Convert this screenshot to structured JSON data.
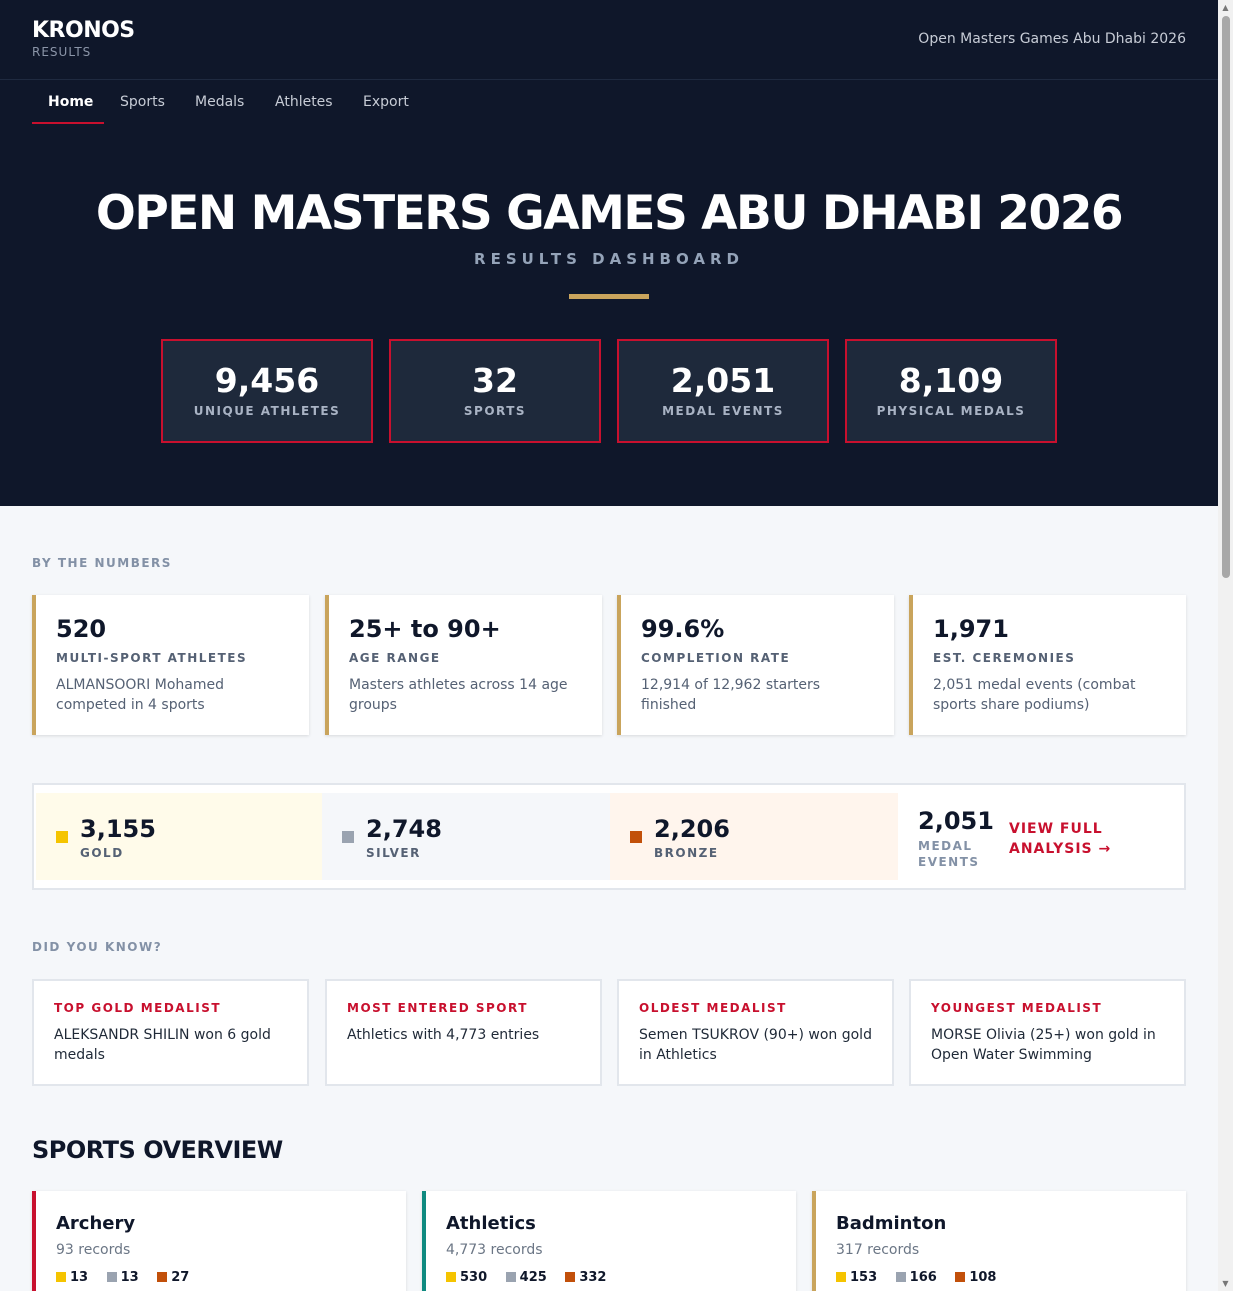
{
  "brand": {
    "name": "KRONOS",
    "sub": "RESULTS"
  },
  "header": {
    "event_name": "Open Masters Games Abu Dhabi 2026"
  },
  "nav": {
    "items": [
      "Home",
      "Sports",
      "Medals",
      "Athletes",
      "Export"
    ],
    "active": "Home"
  },
  "hero": {
    "title": "OPEN MASTERS GAMES ABU DHABI 2026",
    "subtitle": "RESULTS DASHBOARD",
    "stats": [
      {
        "value": "9,456",
        "label": "UNIQUE ATHLETES"
      },
      {
        "value": "32",
        "label": "SPORTS"
      },
      {
        "value": "2,051",
        "label": "MEDAL EVENTS"
      },
      {
        "value": "8,109",
        "label": "PHYSICAL MEDALS"
      }
    ]
  },
  "by_numbers": {
    "label": "BY THE NUMBERS",
    "cards": [
      {
        "value": "520",
        "label": "MULTI-SPORT ATHLETES",
        "desc": "ALMANSOORI Mohamed competed in 4 sports"
      },
      {
        "value": "25+ to 90+",
        "label": "AGE RANGE",
        "desc": "Masters athletes across 14 age groups"
      },
      {
        "value": "99.6%",
        "label": "COMPLETION RATE",
        "desc": "12,914 of 12,962 starters finished"
      },
      {
        "value": "1,971",
        "label": "EST. CEREMONIES",
        "desc": "2,051 medal events (combat sports share podiums)"
      }
    ]
  },
  "medals": {
    "gold": {
      "count": "3,155",
      "label": "GOLD",
      "color": "#f5c400"
    },
    "silver": {
      "count": "2,748",
      "label": "SILVER",
      "color": "#9aa3b0"
    },
    "bronze": {
      "count": "2,206",
      "label": "BRONZE",
      "color": "#c2500a"
    },
    "events": {
      "count": "2,051",
      "label": "MEDAL EVENTS"
    },
    "view_full": "VIEW FULL ANALYSIS →"
  },
  "did_you_know": {
    "label": "DID YOU KNOW?",
    "facts": [
      {
        "title": "TOP GOLD MEDALIST",
        "text": "ALEKSANDR SHILIN won 6 gold medals"
      },
      {
        "title": "MOST ENTERED SPORT",
        "text": "Athletics with 4,773 entries"
      },
      {
        "title": "OLDEST MEDALIST",
        "text": "Semen TSUKROV (90+) won gold in Athletics"
      },
      {
        "title": "YOUNGEST MEDALIST",
        "text": "MORSE Olivia (25+) won gold in Open Water Swimming"
      }
    ]
  },
  "sports_overview": {
    "title": "SPORTS OVERVIEW",
    "sports": [
      {
        "name": "Archery",
        "records": "93 records",
        "gold": "13",
        "silver": "13",
        "bronze": "27",
        "accent": "#c8102e"
      },
      {
        "name": "Athletics",
        "records": "4,773 records",
        "gold": "530",
        "silver": "425",
        "bronze": "332",
        "accent": "#0f8a80"
      },
      {
        "name": "Badminton",
        "records": "317 records",
        "gold": "153",
        "silver": "166",
        "bronze": "108",
        "accent": "#c9a45c"
      }
    ]
  },
  "colors": {
    "navy": "#0f172a",
    "accent_red": "#c8102e",
    "accent_gold": "#c9a45c"
  }
}
